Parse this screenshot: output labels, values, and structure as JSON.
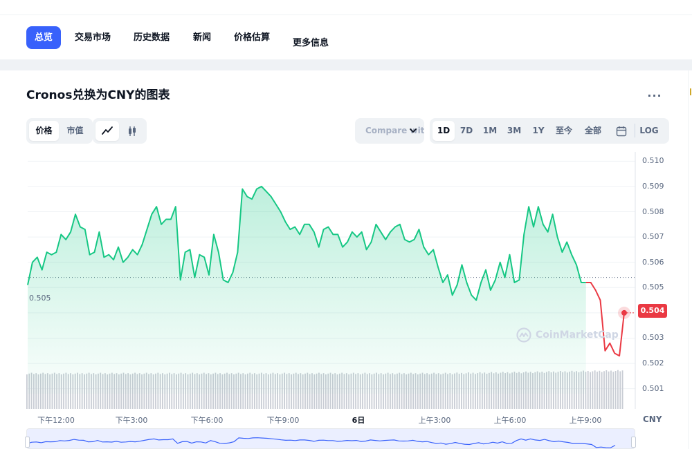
{
  "nav": {
    "tabs": [
      {
        "label": "总览",
        "active": true
      },
      {
        "label": "交易市场"
      },
      {
        "label": "历史数据"
      },
      {
        "label": "新闻"
      },
      {
        "label": "价格估算"
      },
      {
        "label": "更多信息"
      }
    ]
  },
  "chart_header": {
    "title": "Cronos兑换为CNY的图表",
    "more_label": "..."
  },
  "metric_toggle": {
    "price_label": "价格",
    "marketcap_label": "市值",
    "selected": "价格"
  },
  "chart_type_toggle": {
    "selected": "line",
    "line_icon": "line-chart-icon",
    "candle_icon": "candlestick-icon"
  },
  "compare": {
    "label": "Compare with",
    "icon": "chevron-down-icon"
  },
  "ranges": {
    "items": [
      "1D",
      "7D",
      "1M",
      "3M",
      "1Y",
      "至今",
      "全部"
    ],
    "selected": "1D",
    "calendar_icon": "calendar-icon",
    "log_label": "LOG"
  },
  "watermark": {
    "text": "CoinMarketCap"
  },
  "colors": {
    "up": "#16c784",
    "down": "#ea3943",
    "accent": "#3861fb",
    "volume": "#c8ccd4",
    "brush": "#3861fb"
  },
  "chart_data": {
    "type": "line",
    "title": "",
    "xlabel": "",
    "ylabel": "",
    "unit": "CNY",
    "yticks": [
      "0.510",
      "0.509",
      "0.508",
      "0.507",
      "0.506",
      "0.505",
      "0.504",
      "0.503",
      "0.502",
      "0.501"
    ],
    "ylim": [
      0.5008,
      0.5102
    ],
    "reference_price": 0.5054,
    "reference_label": "0.505",
    "current_price_label": "0.504",
    "xticks": [
      "下午12:00",
      "下午3:00",
      "下午6:00",
      "下午9:00",
      "6日",
      "上午3:00",
      "上午6:00",
      "上午9:00"
    ],
    "x_start": "10:45",
    "x_end": "10:40",
    "series": [
      {
        "values": [
          0.5051,
          0.506,
          0.5062,
          0.5057,
          0.5064,
          0.5063,
          0.5064,
          0.5071,
          0.5069,
          0.5072,
          0.5079,
          0.5074,
          0.5073,
          0.5063,
          0.5064,
          0.5072,
          0.5062,
          0.5063,
          0.5061,
          0.5066,
          0.506,
          0.5062,
          0.5065,
          0.5063,
          0.5067,
          0.5073,
          0.5079,
          0.5082,
          0.5075,
          0.5077,
          0.5077,
          0.5082,
          0.5053,
          0.5064,
          0.5065,
          0.5054,
          0.5063,
          0.5062,
          0.5055,
          0.5071,
          0.5064,
          0.5053,
          0.5052,
          0.5056,
          0.5064,
          0.5089,
          0.5086,
          0.5085,
          0.5089,
          0.509,
          0.5088,
          0.5086,
          0.5083,
          0.508,
          0.5076,
          0.5073,
          0.5074,
          0.5071,
          0.5075,
          0.5075,
          0.5072,
          0.5066,
          0.5073,
          0.5074,
          0.5071,
          0.5071,
          0.5066,
          0.5068,
          0.5072,
          0.507,
          0.5072,
          0.5065,
          0.5068,
          0.5075,
          0.5072,
          0.5069,
          0.5072,
          0.5074,
          0.5075,
          0.5069,
          0.5068,
          0.5069,
          0.5073,
          0.5066,
          0.5063,
          0.5065,
          0.5058,
          0.5052,
          0.5055,
          0.5047,
          0.5051,
          0.5059,
          0.5052,
          0.5047,
          0.5045,
          0.5052,
          0.5057,
          0.5049,
          0.5053,
          0.506,
          0.5054,
          0.5063,
          0.5052,
          0.5053,
          0.5071,
          0.5082,
          0.5074,
          0.5082,
          0.5075,
          0.5072,
          0.5079,
          0.507,
          0.5064,
          0.5068,
          0.5063,
          0.5059,
          0.5052,
          0.5052,
          0.5052,
          0.5049,
          0.5045,
          0.5025,
          0.5028,
          0.5024,
          0.5023,
          0.504
        ]
      }
    ],
    "volume": {
      "visible": true,
      "level": "uniform, slightly higher at the right end"
    },
    "grid": true,
    "legend": "none"
  }
}
